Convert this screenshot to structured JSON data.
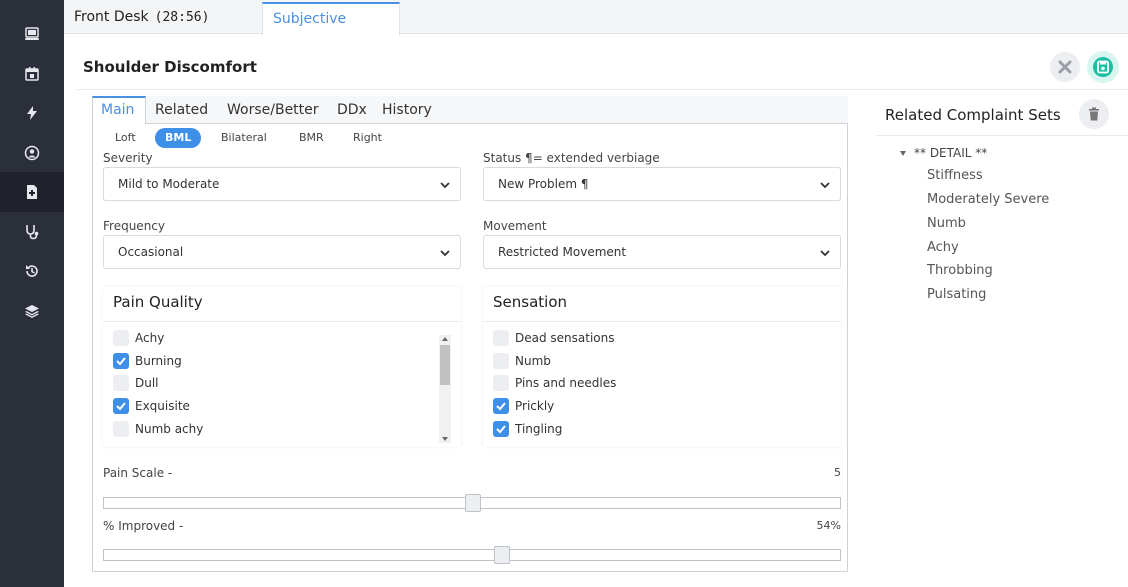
{
  "tabs": {
    "front_desk_label": "Front Desk",
    "front_desk_timer": "(28:56)",
    "subjective_label": "Subjective"
  },
  "sidebar": {
    "items": [
      {
        "icon": "monitor-icon"
      },
      {
        "icon": "calendar-icon"
      },
      {
        "icon": "lightning-icon"
      },
      {
        "icon": "user-circle-icon"
      },
      {
        "icon": "medical-file-icon",
        "active": true
      },
      {
        "icon": "stethoscope-icon"
      },
      {
        "icon": "history-icon"
      },
      {
        "icon": "layers-icon"
      }
    ]
  },
  "panel": {
    "title": "Shoulder Discomfort"
  },
  "subtabs": [
    {
      "label": "Main",
      "active": true
    },
    {
      "label": "Related"
    },
    {
      "label": "Worse/Better"
    },
    {
      "label": "DDx"
    },
    {
      "label": "History"
    }
  ],
  "side_options": [
    {
      "label": "Loft"
    },
    {
      "label": "BML",
      "active": true
    },
    {
      "label": "Bilateral"
    },
    {
      "label": "BMR"
    },
    {
      "label": "Right"
    }
  ],
  "fields": {
    "severity": {
      "label": "Severity",
      "value": "Mild to Moderate"
    },
    "status": {
      "label": "Status ¶= extended verbiage",
      "value": "New Problem ¶"
    },
    "frequency": {
      "label": "Frequency",
      "value": "Occasional"
    },
    "movement": {
      "label": "Movement",
      "value": "Restricted Movement"
    }
  },
  "pain_quality": {
    "title": "Pain Quality",
    "items": [
      {
        "label": "Achy",
        "checked": false
      },
      {
        "label": "Burning",
        "checked": true
      },
      {
        "label": "Dull",
        "checked": false
      },
      {
        "label": "Exquisite",
        "checked": true
      },
      {
        "label": "Numb achy",
        "checked": false
      }
    ]
  },
  "sensation": {
    "title": "Sensation",
    "items": [
      {
        "label": "Dead sensations",
        "checked": false
      },
      {
        "label": "Numb",
        "checked": false
      },
      {
        "label": "Pins and needles",
        "checked": false
      },
      {
        "label": "Prickly",
        "checked": true
      },
      {
        "label": "Tingling",
        "checked": true
      }
    ]
  },
  "pain_scale": {
    "label": "Pain Scale -",
    "value": "5",
    "fraction": 0.5
  },
  "improved": {
    "label": "% Improved -",
    "value": "54%",
    "fraction": 0.54
  },
  "related_sets": {
    "title": "Related Complaint Sets",
    "root": "** DETAIL **",
    "children": [
      "Stiffness",
      "Moderately Severe",
      "Numb",
      "Achy",
      "Throbbing",
      "Pulsating"
    ]
  },
  "colors": {
    "accent": "#4a90e2",
    "checkbox_checked": "#3d8fe8",
    "save_icon": "#1ebea5",
    "sidebar_bg": "#2b2f3a"
  }
}
